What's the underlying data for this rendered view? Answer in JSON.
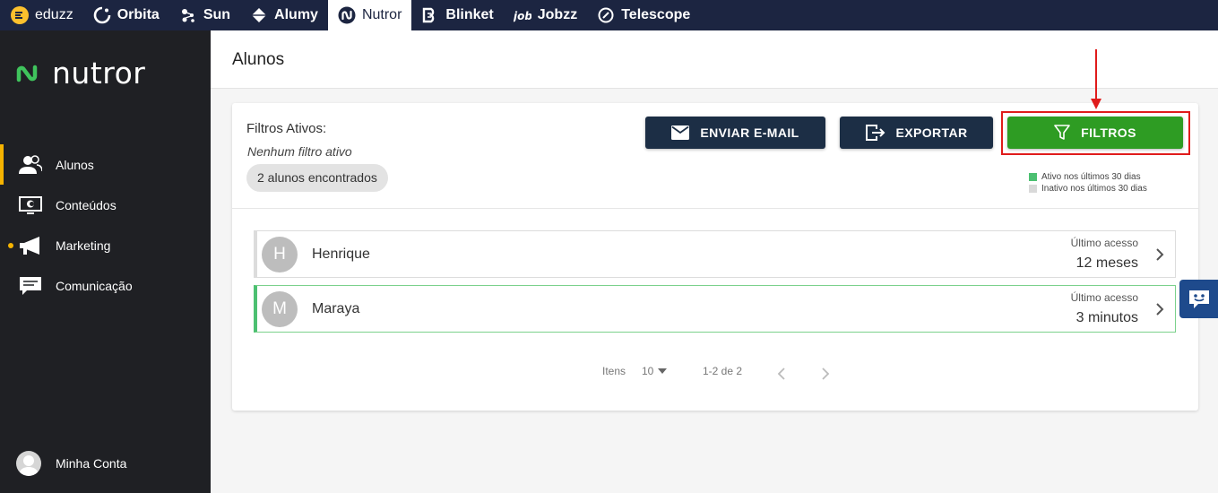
{
  "topbar": {
    "apps": [
      {
        "label": "eduzz",
        "icon": "eduzz-logo-icon"
      },
      {
        "label": "Orbita",
        "icon": "orbita-icon"
      },
      {
        "label": "Sun",
        "icon": "sun-icon"
      },
      {
        "label": "Alumy",
        "icon": "alumy-icon"
      },
      {
        "label": "Nutror",
        "icon": "nutror-icon"
      },
      {
        "label": "Blinket",
        "icon": "blinket-icon"
      },
      {
        "label": "Jobzz",
        "icon": "jobzz-icon"
      },
      {
        "label": "Telescope",
        "icon": "telescope-icon"
      }
    ],
    "active": "Nutror"
  },
  "sidebar": {
    "logo_text": "nutror",
    "items": [
      {
        "label": "Alunos",
        "icon": "students-icon"
      },
      {
        "label": "Conteúdos",
        "icon": "content-monitor-icon"
      },
      {
        "label": "Marketing",
        "icon": "megaphone-icon"
      },
      {
        "label": "Comunicação",
        "icon": "chat-bubble-icon"
      }
    ],
    "account_label": "Minha Conta"
  },
  "page": {
    "title": "Alunos"
  },
  "filters": {
    "label": "Filtros Ativos:",
    "none_text": "Nenhum filtro ativo",
    "count_chip": "2 alunos encontrados"
  },
  "actions": {
    "email_label": "ENVIAR E-MAIL",
    "export_label": "EXPORTAR",
    "filter_label": "FILTROS"
  },
  "legend": {
    "active_label": "Ativo nos últimos 30 dias",
    "inactive_label": "Inativo nos últimos 30 dias",
    "active_color": "#4cc071",
    "inactive_color": "#d9d9d9"
  },
  "students": [
    {
      "initial": "H",
      "name": "Henrique",
      "access_label": "Último acesso",
      "access_value": "12 meses",
      "active": false
    },
    {
      "initial": "M",
      "name": "Maraya",
      "access_label": "Último acesso",
      "access_value": "3 minutos",
      "active": true
    }
  ],
  "pagination": {
    "items_label": "Itens",
    "page_size": "10",
    "range": "1-2 de 2"
  },
  "colors": {
    "topbar_bg": "#1c2541",
    "sidebar_bg": "#1f2024",
    "accent": "#f5b301",
    "primary_button": "#1c2e45",
    "filter_button": "#2e9c23",
    "highlight": "#e01b1b"
  }
}
